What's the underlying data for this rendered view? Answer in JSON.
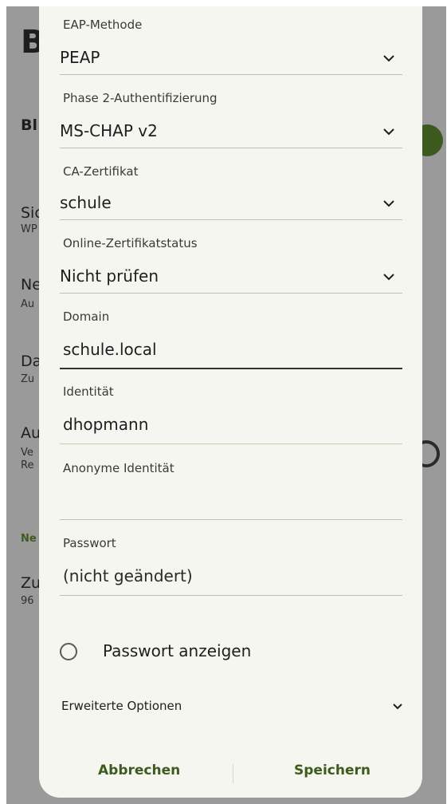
{
  "background": {
    "title": "B",
    "rows": [
      {
        "text": "Bl"
      },
      {
        "title": "Sic",
        "sub": "WP"
      },
      {
        "title": "Ne",
        "sub": "Au"
      },
      {
        "title": "Da",
        "sub": "Zu"
      },
      {
        "title": "Au",
        "sub1": "Ve",
        "sub2": "Re"
      },
      {
        "section": "Ne"
      },
      {
        "title": "Zu",
        "sub": "96"
      }
    ]
  },
  "dialog": {
    "fields": [
      {
        "label": "EAP-Methode",
        "value": "PEAP"
      },
      {
        "label": "Phase 2-Authentifizierung",
        "value": "MS-CHAP v2"
      },
      {
        "label": "CA-Zertifikat",
        "value": "schule"
      },
      {
        "label": "Online-Zertifikatstatus",
        "value": "Nicht prüfen"
      },
      {
        "label": "Domain",
        "value": "schule.local"
      },
      {
        "label": "Identität",
        "value": "dhopmann"
      },
      {
        "label": "Anonyme Identität",
        "value": ""
      },
      {
        "label": "Passwort",
        "value": "(nicht geändert)"
      }
    ],
    "show_password_label": "Passwort anzeigen",
    "show_password_checked": false,
    "advanced_label": "Erweiterte Optionen",
    "cancel_label": "Abbrechen",
    "save_label": "Speichern",
    "accent_color": "#3d5a1f"
  }
}
